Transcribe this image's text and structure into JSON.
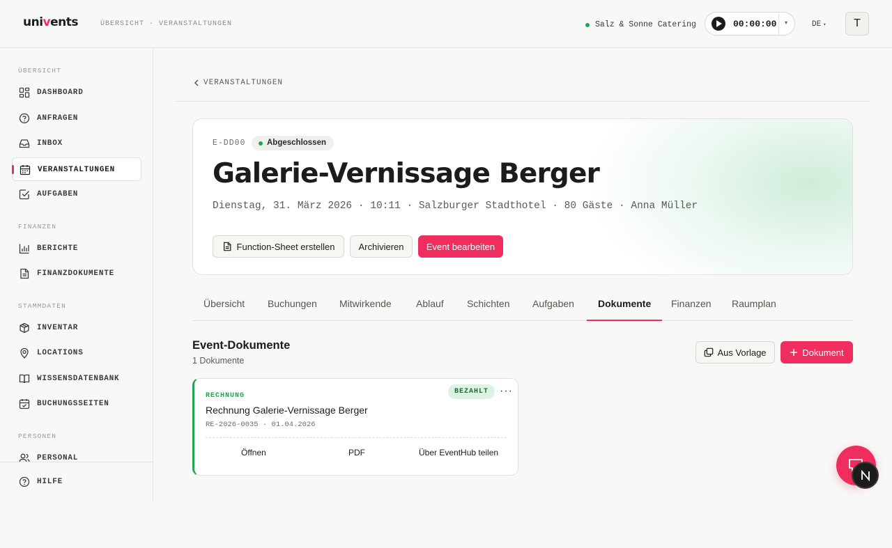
{
  "header": {
    "logo_prefix": "uni",
    "logo_accent": "v",
    "logo_suffix": "ents",
    "breadcrumb": "ÜBERSICHT · VERANSTALTUNGEN",
    "company": "Salz & Sonne Catering",
    "timer": "00:00:00",
    "language": "DE",
    "user_initial": "T"
  },
  "sidebar": {
    "sections": [
      {
        "title": "ÜBERSICHT"
      },
      {
        "title": "FINANZEN"
      },
      {
        "title": "STAMMDATEN"
      },
      {
        "title": "PERSONEN"
      }
    ],
    "items": [
      {
        "label": "DASHBOARD",
        "icon": "dashboard-icon"
      },
      {
        "label": "ANFRAGEN",
        "icon": "question-icon"
      },
      {
        "label": "INBOX",
        "icon": "inbox-icon"
      },
      {
        "label": "VERANSTALTUNGEN",
        "icon": "calendar-icon",
        "active": true
      },
      {
        "label": "AUFGABEN",
        "icon": "checkbox-icon"
      },
      {
        "label": "BERICHTE",
        "icon": "bar-chart-icon"
      },
      {
        "label": "FINANZDOKUMENTE",
        "icon": "document-icon"
      },
      {
        "label": "INVENTAR",
        "icon": "box-icon"
      },
      {
        "label": "LOCATIONS",
        "icon": "location-pin-icon"
      },
      {
        "label": "WISSENSDATENBANK",
        "icon": "book-icon"
      },
      {
        "label": "BUCHUNGSSEITEN",
        "icon": "calendar-check-icon"
      },
      {
        "label": "PERSONAL",
        "icon": "users-icon"
      }
    ],
    "footer_item": {
      "label": "HILFE",
      "icon": "help-icon"
    }
  },
  "page": {
    "back_label": "VERANSTALTUNGEN",
    "event_code": "E-DD00",
    "status": "Abgeschlossen",
    "title": "Galerie-Vernissage Berger",
    "meta": "Dienstag, 31. März 2026 · 10:11 · Salzburger Stadthotel · 80 Gäste · Anna Müller",
    "buttons": {
      "function_sheet": "Function-Sheet erstellen",
      "archive": "Archivieren",
      "edit": "Event bearbeiten"
    }
  },
  "tabs": [
    "Übersicht",
    "Buchungen",
    "Mitwirkende",
    "Ablauf",
    "Schichten",
    "Aufgaben",
    "Dokumente",
    "Finanzen",
    "Raumplan"
  ],
  "active_tab": "Dokumente",
  "documents": {
    "heading": "Event-Dokumente",
    "count": "1 Dokumente",
    "btn_template": "Aus Vorlage",
    "btn_add": "Dokument",
    "items": [
      {
        "type": "RECHNUNG",
        "status": "BEZAHLT",
        "title": "Rechnung Galerie-Vernissage Berger",
        "ref": "RE-2026-0035 · 01.04.2026",
        "actions": [
          "Öffnen",
          "PDF",
          "Über EventHub teilen"
        ]
      }
    ]
  },
  "colors": {
    "accent": "#f02d5f",
    "success": "#22a355"
  }
}
